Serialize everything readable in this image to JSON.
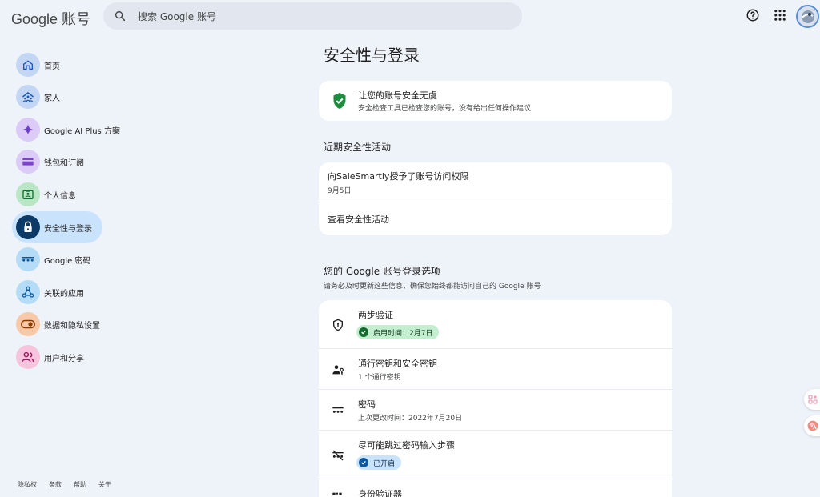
{
  "header": {
    "logo_text": "Google 账号",
    "search_placeholder": "搜索 Google 账号"
  },
  "sidebar": {
    "items": [
      {
        "label": "首页",
        "icon": "home-icon",
        "color": "#c3d7f5"
      },
      {
        "label": "家人",
        "icon": "family-icon",
        "color": "#c3d7f5"
      },
      {
        "label": "Google AI Plus 方案",
        "icon": "sparkle-icon",
        "color": "#dccbf7"
      },
      {
        "label": "钱包和订阅",
        "icon": "wallet-icon",
        "color": "#dccbf7"
      },
      {
        "label": "个人信息",
        "icon": "id-card-icon",
        "color": "#b9e6c4"
      },
      {
        "label": "安全性与登录",
        "icon": "lock-icon",
        "color": "#0b3a66"
      },
      {
        "label": "Google 密码",
        "icon": "password-icon",
        "color": "#b5dcf7"
      },
      {
        "label": "关联的应用",
        "icon": "apps-link-icon",
        "color": "#b5dcf7"
      },
      {
        "label": "数据和隐私设置",
        "icon": "toggle-icon",
        "color": "#f8c9a8"
      },
      {
        "label": "用户和分享",
        "icon": "people-icon",
        "color": "#f7c4de"
      }
    ],
    "footer": [
      "隐私权",
      "条款",
      "帮助",
      "关于"
    ]
  },
  "main": {
    "title": "安全性与登录",
    "checkup": {
      "title": "让您的账号安全无虞",
      "subtitle": "安全检查工具已检查您的账号，没有给出任何操作建议"
    },
    "recent": {
      "section_title": "近期安全性活动",
      "activity_title": "向SaleSmartly授予了账号访问权限",
      "activity_date": "9月5日",
      "view_link": "查看安全性活动"
    },
    "signin": {
      "section_title": "您的 Google 账号登录选项",
      "section_subtitle": "请务必及时更新这些信息，确保您始终都能访问自己的 Google 账号",
      "rows": {
        "two_step": {
          "title": "两步验证",
          "chip": "启用时间：2月7日"
        },
        "passkeys": {
          "title": "通行密钥和安全密钥",
          "sub": "1 个通行密钥"
        },
        "password": {
          "title": "密码",
          "sub": "上次更改时间：2022年7月20日"
        },
        "skip_password": {
          "title": "尽可能跳过密码输入步骤",
          "chip": "已开启"
        },
        "authenticator": {
          "title": "身份验证器"
        }
      }
    }
  }
}
